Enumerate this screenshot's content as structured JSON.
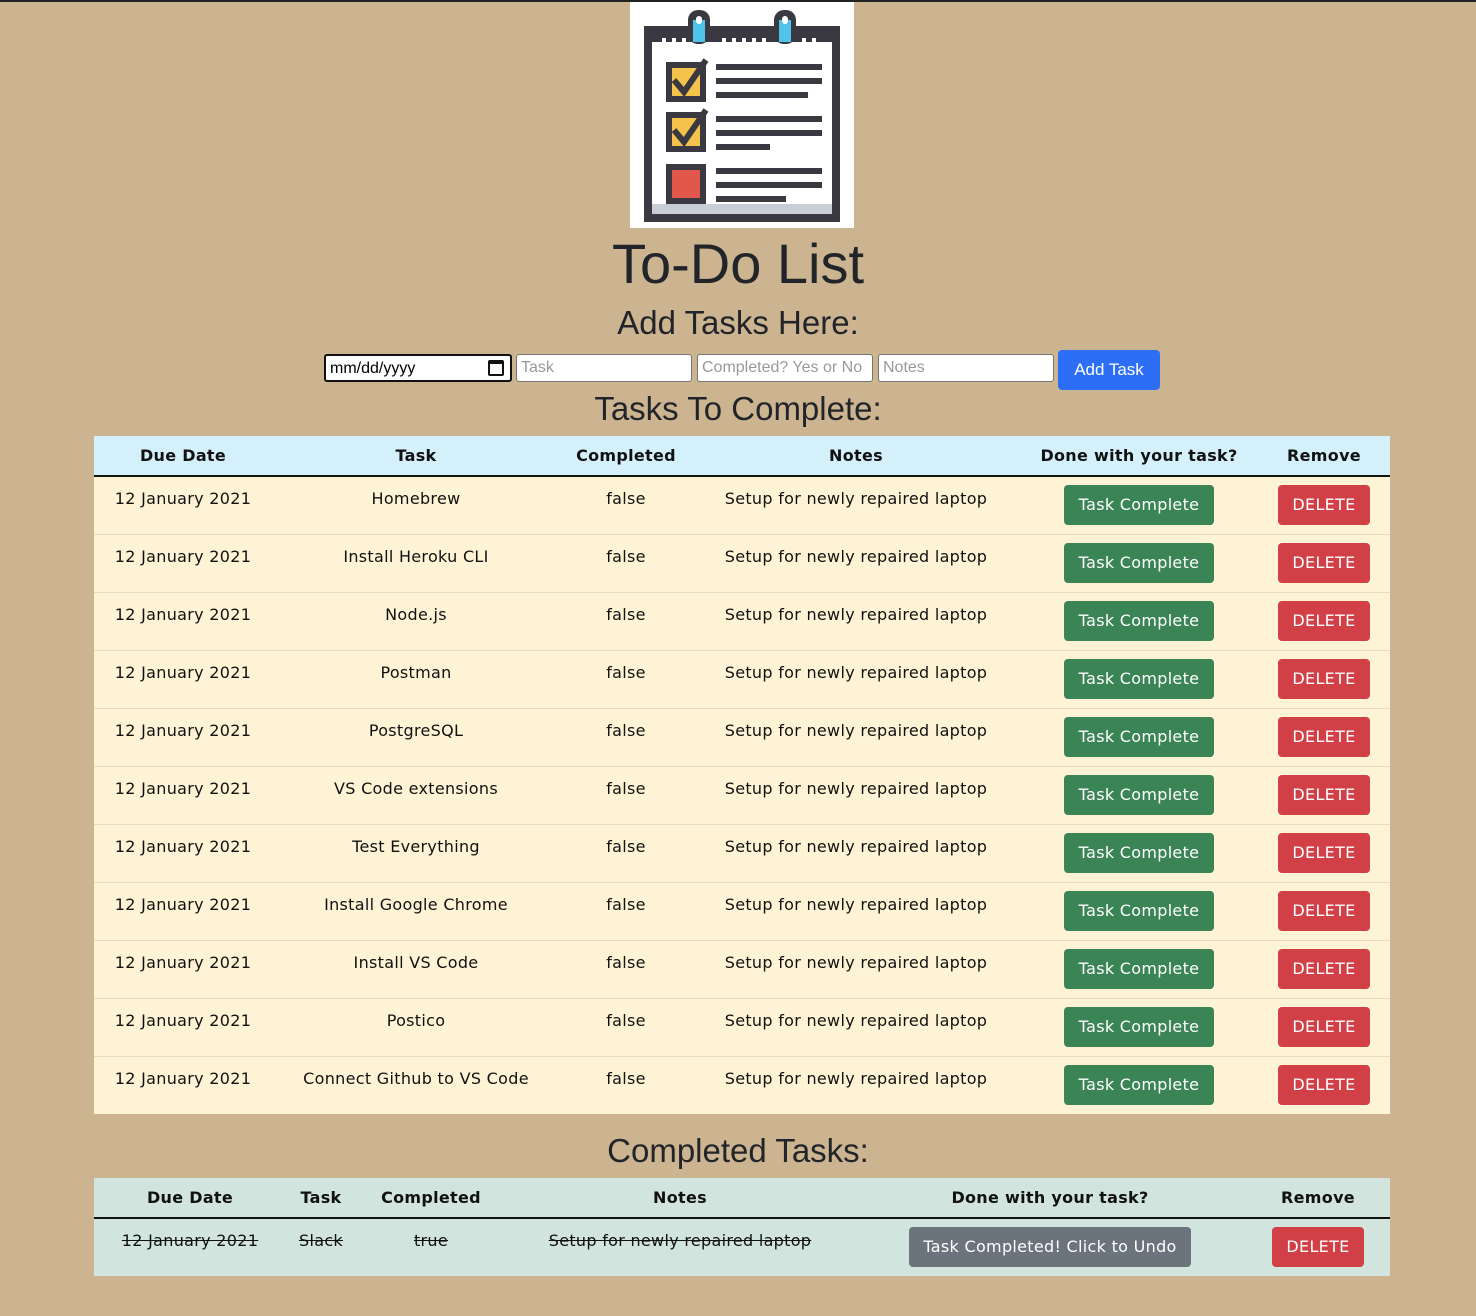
{
  "header": {
    "title": "To-Do List",
    "subtitle": "Add Tasks Here:"
  },
  "form": {
    "date_value": "mm/dd/yyyy",
    "task_placeholder": "Task",
    "completed_placeholder": "Completed? Yes or No",
    "notes_placeholder": "Notes",
    "add_button_label": "Add Task"
  },
  "todo": {
    "section_title": "Tasks To Complete:",
    "columns": [
      "Due Date",
      "Task",
      "Completed",
      "Notes",
      "Done with your task?",
      "Remove"
    ],
    "complete_button_label": "Task Complete",
    "delete_button_label": "DELETE",
    "rows": [
      {
        "due_date": "12 January 2021",
        "task": "Homebrew",
        "completed": "false",
        "notes": "Setup for newly repaired laptop"
      },
      {
        "due_date": "12 January 2021",
        "task": "Install Heroku CLI",
        "completed": "false",
        "notes": "Setup for newly repaired laptop"
      },
      {
        "due_date": "12 January 2021",
        "task": "Node.js",
        "completed": "false",
        "notes": "Setup for newly repaired laptop"
      },
      {
        "due_date": "12 January 2021",
        "task": "Postman",
        "completed": "false",
        "notes": "Setup for newly repaired laptop"
      },
      {
        "due_date": "12 January 2021",
        "task": "PostgreSQL",
        "completed": "false",
        "notes": "Setup for newly repaired laptop"
      },
      {
        "due_date": "12 January 2021",
        "task": "VS Code extensions",
        "completed": "false",
        "notes": "Setup for newly repaired laptop"
      },
      {
        "due_date": "12 January 2021",
        "task": "Test Everything",
        "completed": "false",
        "notes": "Setup for newly repaired laptop"
      },
      {
        "due_date": "12 January 2021",
        "task": "Install Google Chrome",
        "completed": "false",
        "notes": "Setup for newly repaired laptop"
      },
      {
        "due_date": "12 January 2021",
        "task": "Install VS Code",
        "completed": "false",
        "notes": "Setup for newly repaired laptop"
      },
      {
        "due_date": "12 January 2021",
        "task": "Postico",
        "completed": "false",
        "notes": "Setup for newly repaired laptop"
      },
      {
        "due_date": "12 January 2021",
        "task": "Connect Github to VS Code",
        "completed": "false",
        "notes": "Setup for newly repaired laptop"
      }
    ]
  },
  "done": {
    "section_title": "Completed Tasks:",
    "columns": [
      "Due Date",
      "Task",
      "Completed",
      "Notes",
      "Done with your task?",
      "Remove"
    ],
    "undo_button_label": "Task Completed! Click to Undo",
    "delete_button_label": "DELETE",
    "rows": [
      {
        "due_date": "12 January 2021",
        "task": "Slack",
        "completed": "true",
        "notes": "Setup for newly repaired laptop"
      }
    ]
  },
  "colors": {
    "page_bg": "#cdb491",
    "primary": "#2c6ff6",
    "success": "#3b8455",
    "danger": "#d13f47",
    "secondary": "#6b737c",
    "todo_header_bg": "#d4f0fb",
    "todo_row_bg": "#fef3d4",
    "done_bg": "#d1e5de"
  }
}
